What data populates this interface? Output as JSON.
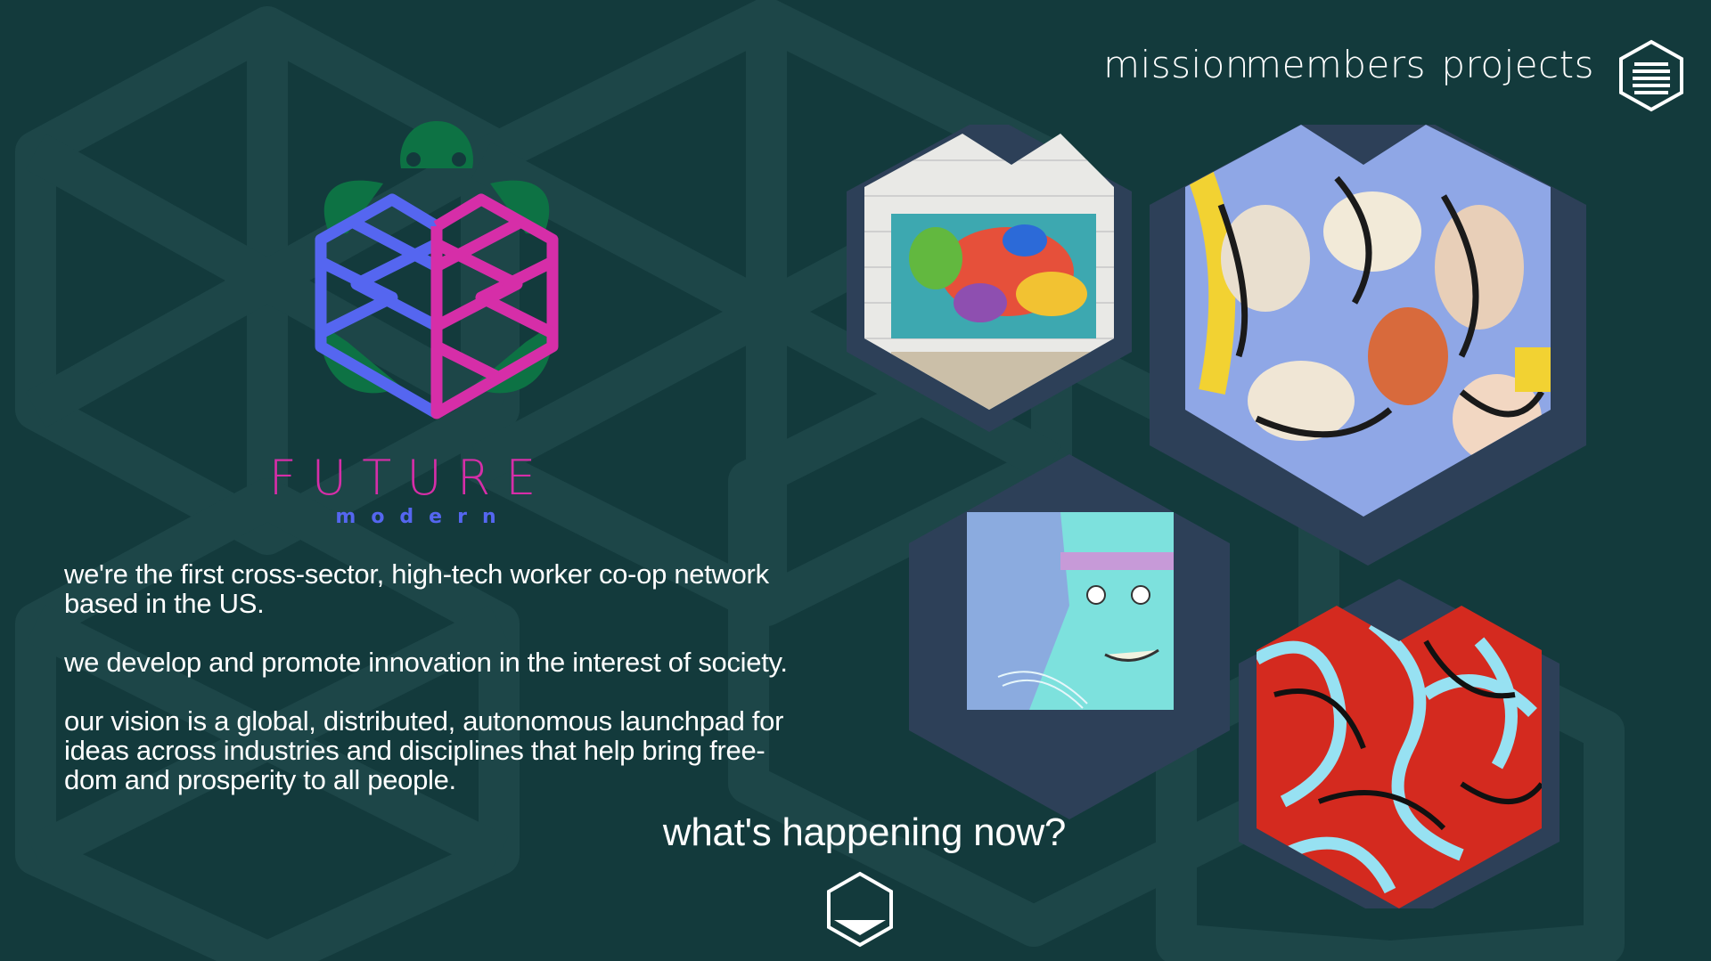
{
  "nav": {
    "items": [
      {
        "label": "mission"
      },
      {
        "label": "members"
      },
      {
        "label": "projects"
      }
    ],
    "menu_icon": "hamburger-hexagon-icon"
  },
  "logo": {
    "icon": "turtle-heart-logo",
    "title": "FUTURE",
    "subtitle": "modern",
    "colors": {
      "turtle": "#0d7244",
      "left_heart": "#5566f0",
      "right_heart": "#d62ea8"
    }
  },
  "intro": {
    "paragraphs": [
      "we're the first cross-sector, high-tech worker co-op network based in the US.",
      "we develop and promote innovation in the interest of society.",
      "our vision is a global, distributed, autonomous launchpad for ideas across industries and disciplines that help bring free-dom and prosperity to all people."
    ]
  },
  "happening": {
    "label": "what's happening now?",
    "scroll_icon": "hexagon-down-icon"
  },
  "gallery": {
    "tiles": [
      {
        "name": "mural-painting",
        "frame": "#2d4058"
      },
      {
        "name": "abstract-figures-painting",
        "frame": "#2d4058"
      },
      {
        "name": "digital-face-art",
        "frame": "#2d4058"
      },
      {
        "name": "red-blue-swirl-art",
        "frame": "#2d4058"
      }
    ]
  },
  "colors": {
    "background": "#133a3c",
    "pattern": "#1f4a4d",
    "text": "#ffffff"
  }
}
